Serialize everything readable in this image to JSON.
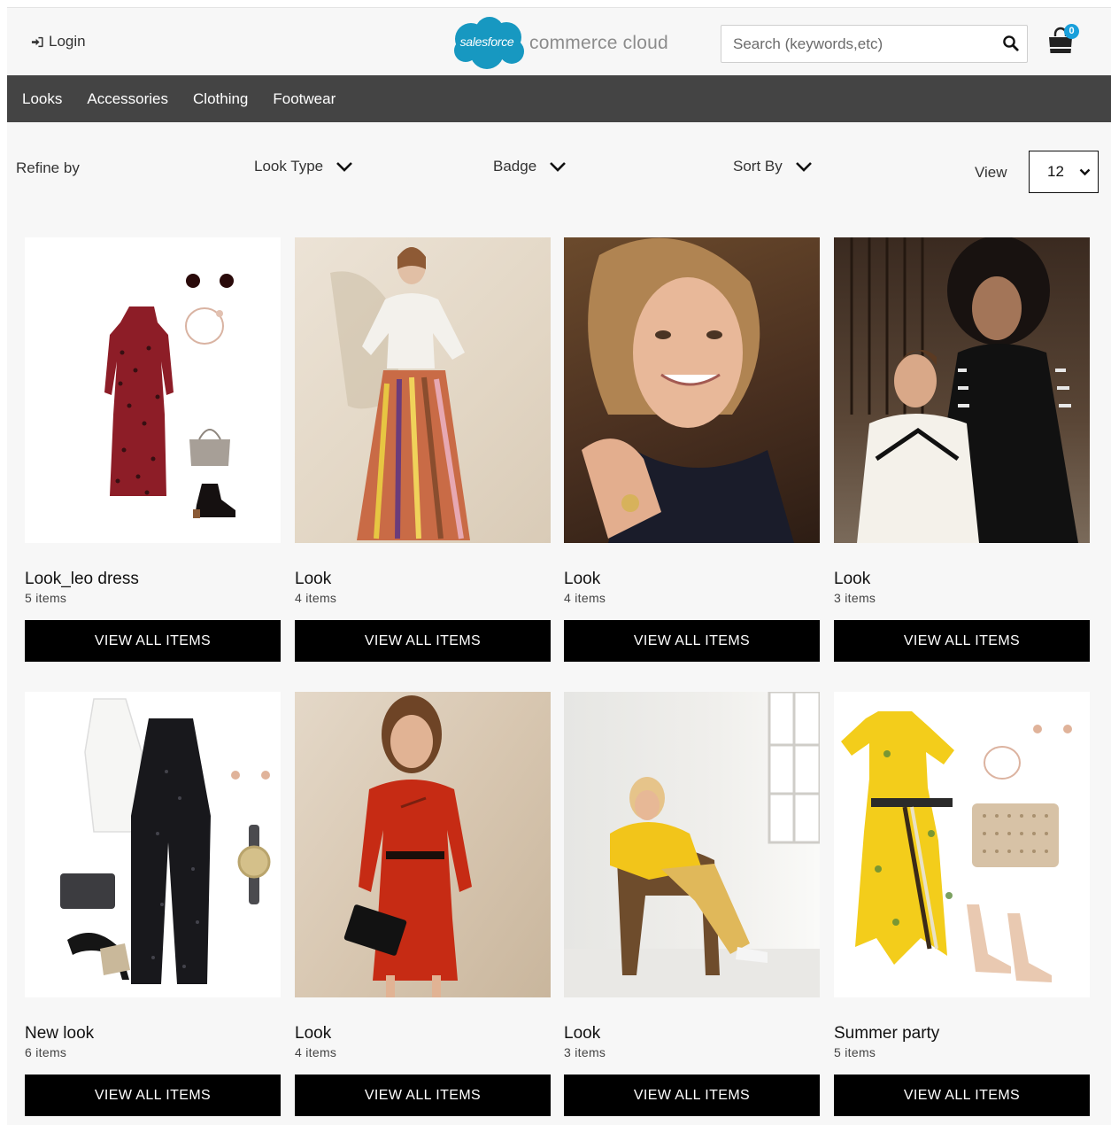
{
  "header": {
    "login_label": "Login",
    "logo_cloud_text": "salesforce",
    "logo_text": "commerce cloud",
    "search_placeholder": "Search (keywords,etc)",
    "cart_count": "0"
  },
  "nav": {
    "items": [
      {
        "label": "Looks"
      },
      {
        "label": "Accessories"
      },
      {
        "label": "Clothing"
      },
      {
        "label": "Footwear"
      }
    ]
  },
  "refine": {
    "label": "Refine by",
    "filters": [
      {
        "label": "Look Type"
      },
      {
        "label": "Badge"
      },
      {
        "label": "Sort By"
      }
    ],
    "view_label": "View",
    "view_value": "12"
  },
  "colors": {
    "nav_bg": "#444444",
    "button_bg": "#000000",
    "cart_badge": "#1aa0db",
    "logo_cloud": "#1798c1"
  },
  "looks": [
    {
      "title": "Look_leo dress",
      "count": "5 items",
      "button": "VIEW ALL ITEMS",
      "image": "flatlay-leopard-dress"
    },
    {
      "title": "Look",
      "count": "4 items",
      "button": "VIEW ALL ITEMS",
      "image": "model-striped-skirt"
    },
    {
      "title": "Look",
      "count": "4 items",
      "button": "VIEW ALL ITEMS",
      "image": "model-portrait-smiling"
    },
    {
      "title": "Look",
      "count": "3 items",
      "button": "VIEW ALL ITEMS",
      "image": "two-models-knitwear"
    },
    {
      "title": "New look",
      "count": "6 items",
      "button": "VIEW ALL ITEMS",
      "image": "flatlay-sequin-jumpsuit"
    },
    {
      "title": "Look",
      "count": "4 items",
      "button": "VIEW ALL ITEMS",
      "image": "model-red-dress"
    },
    {
      "title": "Look",
      "count": "3 items",
      "button": "VIEW ALL ITEMS",
      "image": "model-yellow-sweater-chair"
    },
    {
      "title": "Summer party",
      "count": "5 items",
      "button": "VIEW ALL ITEMS",
      "image": "flatlay-yellow-dress"
    }
  ]
}
